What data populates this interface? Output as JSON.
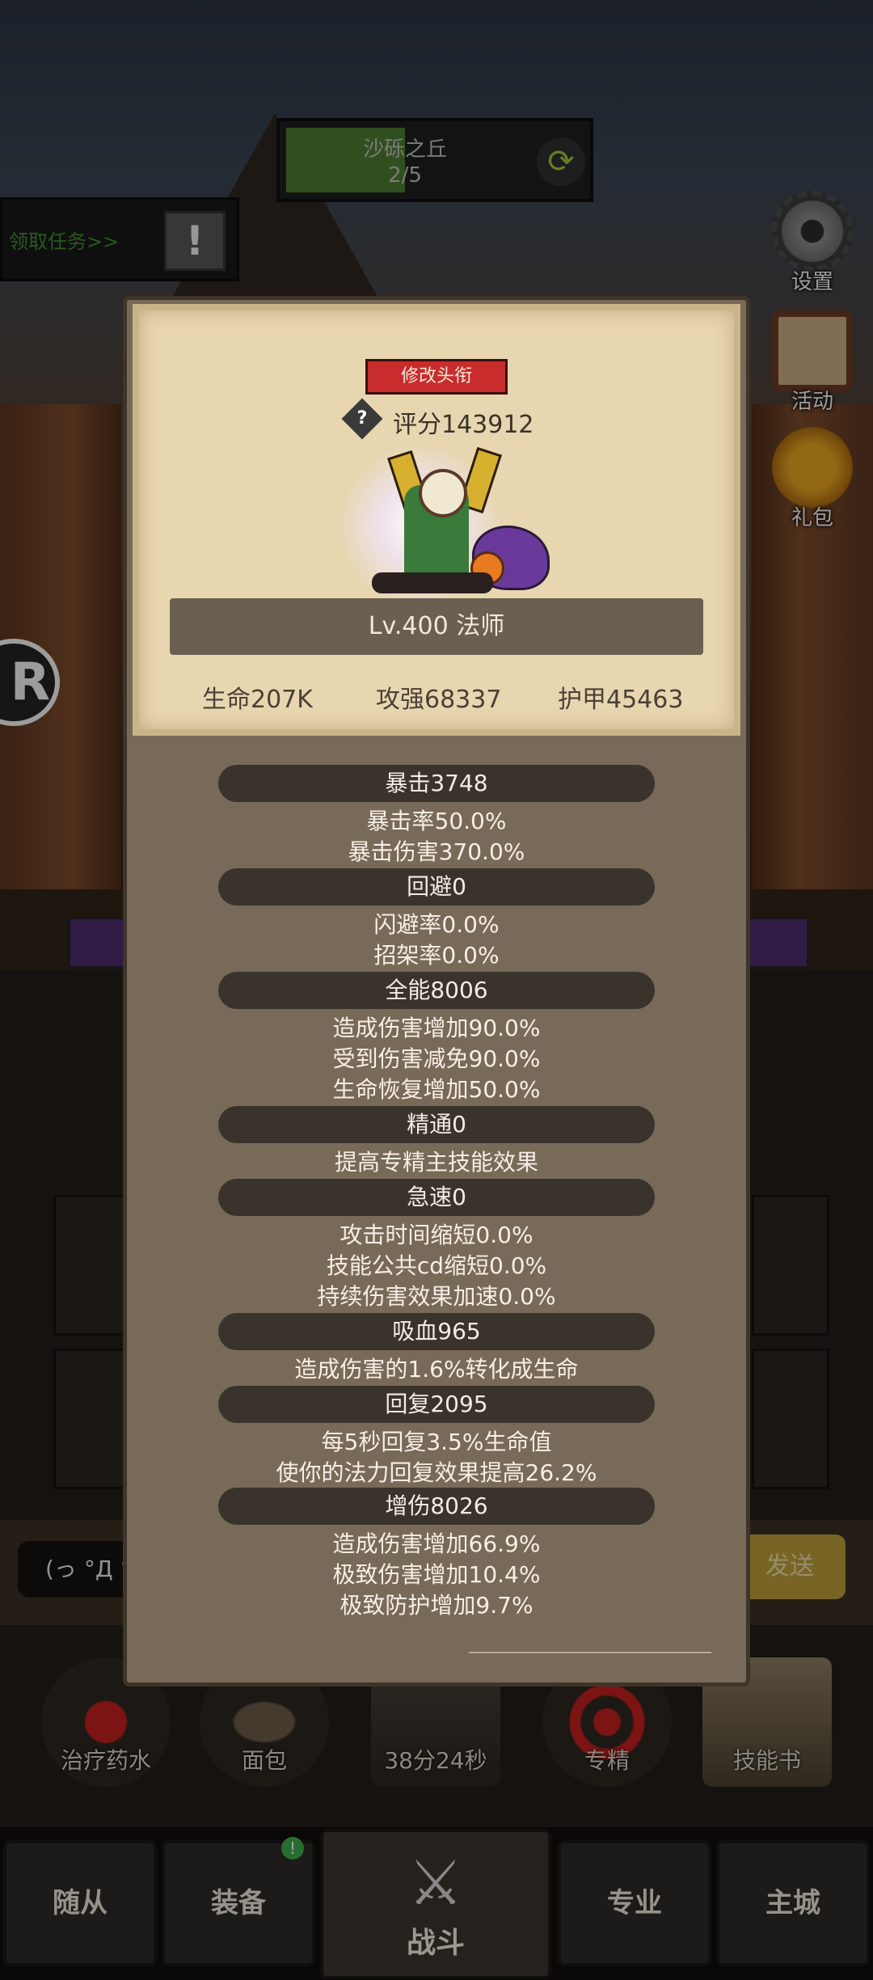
{
  "stage": {
    "name": "沙砾之丘",
    "progress_text": "2/5",
    "progress_fraction": 0.4,
    "refresh_icon": "refresh-icon"
  },
  "quest": {
    "label": "领取任务>>",
    "alert": "!"
  },
  "side_buttons": [
    {
      "label": "设置",
      "icon": "gear-icon"
    },
    {
      "label": "活动",
      "icon": "calendar-icon"
    },
    {
      "label": "礼包",
      "icon": "gift-icon"
    }
  ],
  "round_badge": "R",
  "chat": {
    "input_text": "(っ °Д °",
    "send_label": "发送"
  },
  "items": [
    {
      "label": "治疗药水",
      "icon": "potion-icon"
    },
    {
      "label": "面包",
      "icon": "bread-icon"
    },
    {
      "label": "38分24秒",
      "icon": "chest-icon"
    },
    {
      "label": "专精",
      "icon": "target-icon"
    },
    {
      "label": "技能书",
      "icon": "book-icon"
    }
  ],
  "nav": {
    "followers": "随从",
    "equipment": "装备",
    "battle": "战斗",
    "profession": "专业",
    "city": "主城",
    "equipment_badge": "!"
  },
  "panel": {
    "title_button": "修改头衔",
    "score": "评分143912",
    "score_icon": "?",
    "level_class": "Lv.400 法师",
    "stats": {
      "hp": "生命207K",
      "attack": "攻强68337",
      "armor": "护甲45463"
    },
    "sections": [
      {
        "title": "暴击3748",
        "lines": [
          "暴击率50.0%",
          "暴击伤害370.0%"
        ]
      },
      {
        "title": "回避0",
        "lines": [
          "闪避率0.0%",
          "招架率0.0%"
        ]
      },
      {
        "title": "全能8006",
        "lines": [
          "造成伤害增加90.0%",
          "受到伤害减免90.0%",
          "生命恢复增加50.0%"
        ]
      },
      {
        "title": "精通0",
        "lines": [
          "提高专精主技能效果"
        ]
      },
      {
        "title": "急速0",
        "lines": [
          "攻击时间缩短0.0%",
          "技能公共cd缩短0.0%",
          "持续伤害效果加速0.0%"
        ]
      },
      {
        "title": "吸血965",
        "lines": [
          "造成伤害的1.6%转化成生命"
        ]
      },
      {
        "title": "回复2095",
        "lines": [
          "每5秒回复3.5%生命值",
          "使你的法力回复效果提高26.2%"
        ]
      },
      {
        "title": "增伤8026",
        "lines": [
          "造成伤害增加66.9%",
          "极致伤害增加10.4%",
          "极致防护增加9.7%"
        ]
      }
    ]
  },
  "colors": {
    "title_button": "#c82c2c",
    "card": "#e8d6b0",
    "panel": "#786a58",
    "section_bar": "#3a332c",
    "stage_fill": "#4c7a2e"
  }
}
